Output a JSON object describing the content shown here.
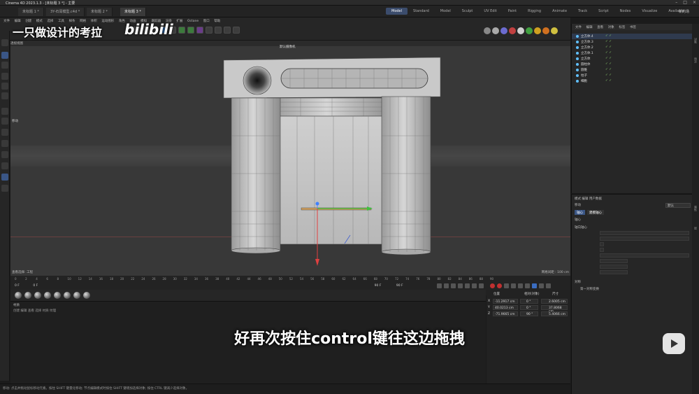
{
  "window": {
    "title": "Cinema 4D 2023.1.3 - [未标题 3 *] - 主要"
  },
  "tabs": [
    "未标题 1 *",
    "3Y-石膏模型.c4d *",
    "未标题 2 *",
    "未标题 3 *"
  ],
  "layouts": [
    "Model",
    "Standard",
    "Model",
    "Sculpt",
    "UV Edit",
    "Paint",
    "Rigging",
    "Animate",
    "Track",
    "Script",
    "Nodes",
    "Visualize",
    "Available"
  ],
  "new_scene": "新的场",
  "menu": [
    "文件",
    "编辑",
    "创建",
    "模式",
    "选择",
    "工具",
    "样条",
    "网格",
    "体积",
    "运动图形",
    "角色",
    "动画",
    "模拟",
    "跟踪器",
    "渲染",
    "扩展",
    "Octane",
    "窗口",
    "帮助"
  ],
  "watermark": {
    "text": "一只做设计的考拉",
    "logo": "bilibili"
  },
  "viewport": {
    "title": "透视视图",
    "camera": "默认摄像机",
    "move_label": "移动",
    "footer_left": "查看选择: 工程",
    "footer_right": "网格间距 : 100 cm"
  },
  "timeline": {
    "ticks": [
      "0",
      "2",
      "4",
      "6",
      "8",
      "10",
      "12",
      "14",
      "16",
      "18",
      "20",
      "22",
      "24",
      "26",
      "28",
      "30",
      "32",
      "34",
      "36",
      "38",
      "40",
      "42",
      "44",
      "46",
      "48",
      "50",
      "52",
      "54",
      "56",
      "58",
      "60",
      "62",
      "64",
      "66",
      "68",
      "70",
      "72",
      "74",
      "76",
      "78",
      "80",
      "82",
      "84",
      "86",
      "88",
      "90"
    ],
    "start": "0 F",
    "current": "0 F",
    "end": "90 F",
    "end2": "90 F",
    "right_current": "0 F"
  },
  "material_panel": {
    "header": "材质",
    "menu": "创建  编辑  查看  选择  材质  纹理"
  },
  "coords": {
    "headers": [
      "位置",
      "尺寸",
      "旋转"
    ],
    "mode_left": "相对(对象)",
    "mode_right": "尺寸",
    "rows": [
      {
        "axis": "X",
        "pos": "-11.2917 cm",
        "rot": "0 °",
        "size": "2.6005 cm"
      },
      {
        "axis": "Y",
        "pos": "40.0213 cm",
        "rot": "0 °",
        "size": "37.8068 cm"
      },
      {
        "axis": "Z",
        "pos": "-71.9665 cm",
        "rot": "90 °",
        "size": "5.4066 cm"
      }
    ]
  },
  "subtitle": "好再次按住control键往这边拖拽",
  "object_manager": {
    "menu": [
      "文件",
      "编辑",
      "查看",
      "对象",
      "标签",
      "书签"
    ],
    "items": [
      {
        "name": "立方体.4",
        "selected": true
      },
      {
        "name": "立方体.3",
        "selected": false
      },
      {
        "name": "立方体.2",
        "selected": false
      },
      {
        "name": "立方体.1",
        "selected": false
      },
      {
        "name": "立方体",
        "selected": false
      },
      {
        "name": "圆柱体",
        "selected": false
      },
      {
        "name": "圆锥",
        "selected": false
      },
      {
        "name": "柱子",
        "selected": false
      },
      {
        "name": "细胞",
        "selected": false
      }
    ]
  },
  "attribute_manager": {
    "menu": "模式  编辑  用户数据",
    "section": "移动",
    "btn_axis": "轴心",
    "btn_modeling": "建模轴心",
    "heading": "轴心",
    "sub1": "轴向轴心",
    "dropdown": "默认",
    "sub2": "对称",
    "sym_label": "第一对称变换"
  },
  "bottom_status": "移动: 点击并拖动鼠标移动元素。按住 SHIFT 键量化移动; 节点编辑模式时按住 SHIFT 键增加选择对象; 按住 CTRL 键减少选择对象。",
  "colors": {
    "accent": "#3a5686",
    "selection": "#2f3a4e"
  }
}
